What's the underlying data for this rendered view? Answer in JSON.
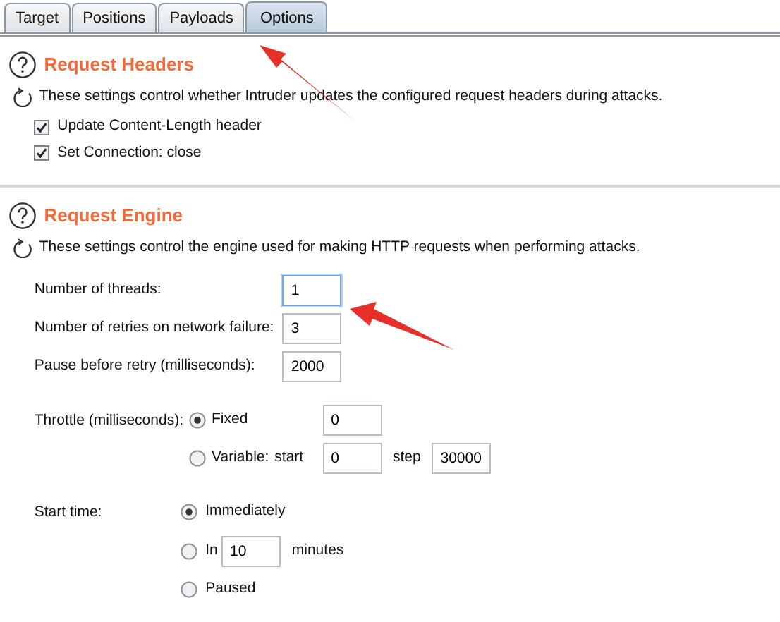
{
  "tabs": [
    {
      "label": "Target",
      "selected": false
    },
    {
      "label": "Positions",
      "selected": false
    },
    {
      "label": "Payloads",
      "selected": false
    },
    {
      "label": "Options",
      "selected": true
    }
  ],
  "sections": [
    {
      "title": "Request Headers",
      "description": "These settings control whether Intruder updates the configured request headers during attacks.",
      "checkboxes": [
        {
          "label": "Update Content-Length header",
          "checked": true
        },
        {
          "label": "Set Connection: close",
          "checked": true
        }
      ]
    },
    {
      "title": "Request Engine",
      "description": "These settings control the engine used for making HTTP requests when performing attacks.",
      "fields": [
        {
          "label": "Number of threads:",
          "value": "1",
          "focused": true
        },
        {
          "label": "Number of retries on network failure:",
          "value": "3",
          "focused": false
        },
        {
          "label": "Pause before retry (milliseconds):",
          "value": "2000",
          "focused": false
        }
      ],
      "radio_groups": [
        {
          "kind": "aligned",
          "label": "Throttle (milliseconds):",
          "options": [
            {
              "selected": true,
              "label": "Fixed",
              "parts": [
                {
                  "kind": "field",
                  "value": "0"
                }
              ]
            },
            {
              "selected": false,
              "label": "Variable:",
              "parts": [
                {
                  "kind": "text",
                  "text": "start"
                },
                {
                  "kind": "field",
                  "value": "0"
                },
                {
                  "kind": "text",
                  "text": "step"
                },
                {
                  "kind": "field",
                  "value": "30000"
                }
              ]
            }
          ]
        },
        {
          "kind": "inline",
          "label": "Start time:",
          "options": [
            {
              "selected": true,
              "label": "Immediately"
            },
            {
              "selected": false,
              "label": "In",
              "parts": [
                {
                  "kind": "field",
                  "value": "10"
                },
                {
                  "kind": "text",
                  "text": "minutes"
                }
              ]
            },
            {
              "selected": false,
              "label": "Paused"
            }
          ]
        }
      ]
    }
  ]
}
